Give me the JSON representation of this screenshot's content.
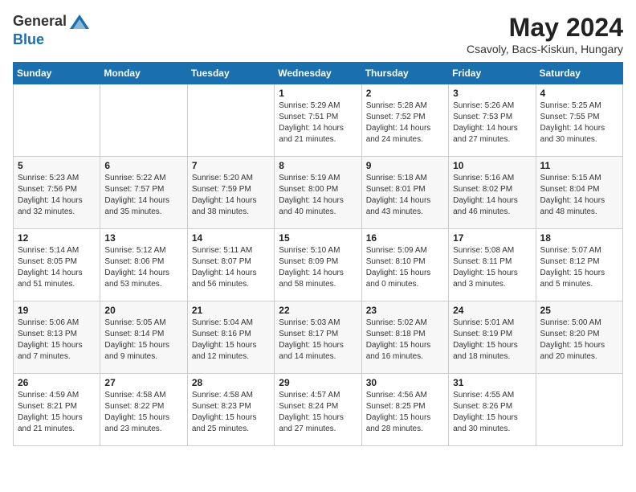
{
  "header": {
    "logo_general": "General",
    "logo_blue": "Blue",
    "title": "May 2024",
    "location": "Csavoly, Bacs-Kiskun, Hungary"
  },
  "days_of_week": [
    "Sunday",
    "Monday",
    "Tuesday",
    "Wednesday",
    "Thursday",
    "Friday",
    "Saturday"
  ],
  "weeks": [
    [
      {
        "day": "",
        "info": ""
      },
      {
        "day": "",
        "info": ""
      },
      {
        "day": "",
        "info": ""
      },
      {
        "day": "1",
        "info": "Sunrise: 5:29 AM\nSunset: 7:51 PM\nDaylight: 14 hours\nand 21 minutes."
      },
      {
        "day": "2",
        "info": "Sunrise: 5:28 AM\nSunset: 7:52 PM\nDaylight: 14 hours\nand 24 minutes."
      },
      {
        "day": "3",
        "info": "Sunrise: 5:26 AM\nSunset: 7:53 PM\nDaylight: 14 hours\nand 27 minutes."
      },
      {
        "day": "4",
        "info": "Sunrise: 5:25 AM\nSunset: 7:55 PM\nDaylight: 14 hours\nand 30 minutes."
      }
    ],
    [
      {
        "day": "5",
        "info": "Sunrise: 5:23 AM\nSunset: 7:56 PM\nDaylight: 14 hours\nand 32 minutes."
      },
      {
        "day": "6",
        "info": "Sunrise: 5:22 AM\nSunset: 7:57 PM\nDaylight: 14 hours\nand 35 minutes."
      },
      {
        "day": "7",
        "info": "Sunrise: 5:20 AM\nSunset: 7:59 PM\nDaylight: 14 hours\nand 38 minutes."
      },
      {
        "day": "8",
        "info": "Sunrise: 5:19 AM\nSunset: 8:00 PM\nDaylight: 14 hours\nand 40 minutes."
      },
      {
        "day": "9",
        "info": "Sunrise: 5:18 AM\nSunset: 8:01 PM\nDaylight: 14 hours\nand 43 minutes."
      },
      {
        "day": "10",
        "info": "Sunrise: 5:16 AM\nSunset: 8:02 PM\nDaylight: 14 hours\nand 46 minutes."
      },
      {
        "day": "11",
        "info": "Sunrise: 5:15 AM\nSunset: 8:04 PM\nDaylight: 14 hours\nand 48 minutes."
      }
    ],
    [
      {
        "day": "12",
        "info": "Sunrise: 5:14 AM\nSunset: 8:05 PM\nDaylight: 14 hours\nand 51 minutes."
      },
      {
        "day": "13",
        "info": "Sunrise: 5:12 AM\nSunset: 8:06 PM\nDaylight: 14 hours\nand 53 minutes."
      },
      {
        "day": "14",
        "info": "Sunrise: 5:11 AM\nSunset: 8:07 PM\nDaylight: 14 hours\nand 56 minutes."
      },
      {
        "day": "15",
        "info": "Sunrise: 5:10 AM\nSunset: 8:09 PM\nDaylight: 14 hours\nand 58 minutes."
      },
      {
        "day": "16",
        "info": "Sunrise: 5:09 AM\nSunset: 8:10 PM\nDaylight: 15 hours\nand 0 minutes."
      },
      {
        "day": "17",
        "info": "Sunrise: 5:08 AM\nSunset: 8:11 PM\nDaylight: 15 hours\nand 3 minutes."
      },
      {
        "day": "18",
        "info": "Sunrise: 5:07 AM\nSunset: 8:12 PM\nDaylight: 15 hours\nand 5 minutes."
      }
    ],
    [
      {
        "day": "19",
        "info": "Sunrise: 5:06 AM\nSunset: 8:13 PM\nDaylight: 15 hours\nand 7 minutes."
      },
      {
        "day": "20",
        "info": "Sunrise: 5:05 AM\nSunset: 8:14 PM\nDaylight: 15 hours\nand 9 minutes."
      },
      {
        "day": "21",
        "info": "Sunrise: 5:04 AM\nSunset: 8:16 PM\nDaylight: 15 hours\nand 12 minutes."
      },
      {
        "day": "22",
        "info": "Sunrise: 5:03 AM\nSunset: 8:17 PM\nDaylight: 15 hours\nand 14 minutes."
      },
      {
        "day": "23",
        "info": "Sunrise: 5:02 AM\nSunset: 8:18 PM\nDaylight: 15 hours\nand 16 minutes."
      },
      {
        "day": "24",
        "info": "Sunrise: 5:01 AM\nSunset: 8:19 PM\nDaylight: 15 hours\nand 18 minutes."
      },
      {
        "day": "25",
        "info": "Sunrise: 5:00 AM\nSunset: 8:20 PM\nDaylight: 15 hours\nand 20 minutes."
      }
    ],
    [
      {
        "day": "26",
        "info": "Sunrise: 4:59 AM\nSunset: 8:21 PM\nDaylight: 15 hours\nand 21 minutes."
      },
      {
        "day": "27",
        "info": "Sunrise: 4:58 AM\nSunset: 8:22 PM\nDaylight: 15 hours\nand 23 minutes."
      },
      {
        "day": "28",
        "info": "Sunrise: 4:58 AM\nSunset: 8:23 PM\nDaylight: 15 hours\nand 25 minutes."
      },
      {
        "day": "29",
        "info": "Sunrise: 4:57 AM\nSunset: 8:24 PM\nDaylight: 15 hours\nand 27 minutes."
      },
      {
        "day": "30",
        "info": "Sunrise: 4:56 AM\nSunset: 8:25 PM\nDaylight: 15 hours\nand 28 minutes."
      },
      {
        "day": "31",
        "info": "Sunrise: 4:55 AM\nSunset: 8:26 PM\nDaylight: 15 hours\nand 30 minutes."
      },
      {
        "day": "",
        "info": ""
      }
    ]
  ]
}
